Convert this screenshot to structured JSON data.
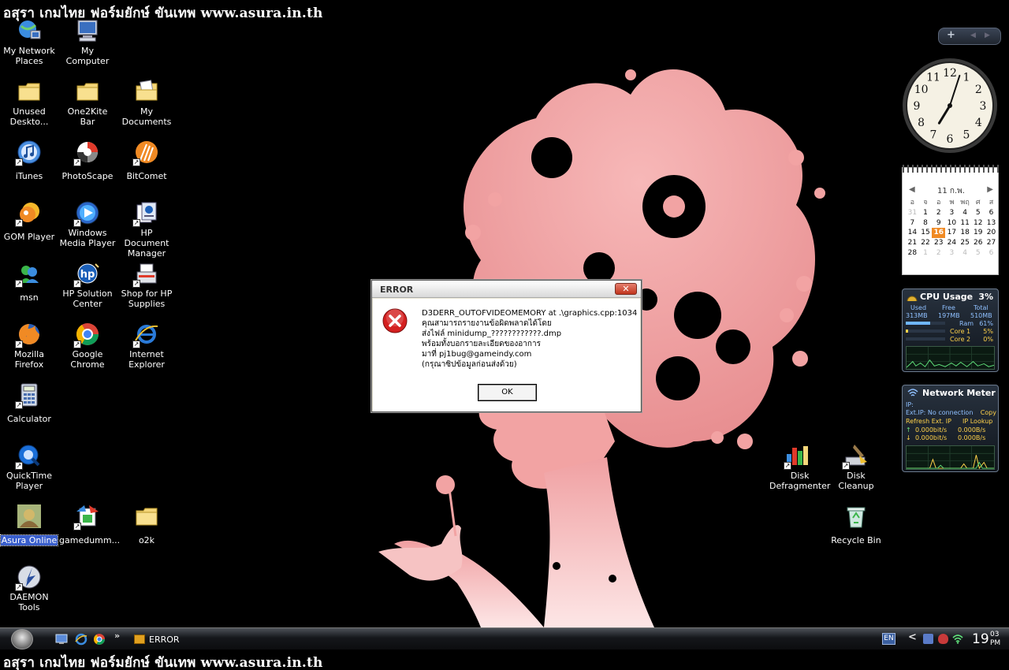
{
  "banner_text": "อสุรา เกมไทย ฟอร์มยักษ์ ขันเทพ www.asura.in.th",
  "desktop_icons": [
    {
      "label": "My Network Places",
      "icon": "network-places-icon"
    },
    {
      "label": "My Computer",
      "icon": "computer-icon"
    },
    {
      "label": "Unused Deskto...",
      "icon": "folder-icon"
    },
    {
      "label": "One2Kite Bar",
      "icon": "folder-icon"
    },
    {
      "label": "My Documents",
      "icon": "documents-folder-icon"
    },
    {
      "label": "iTunes",
      "icon": "itunes-icon"
    },
    {
      "label": "PhotoScape",
      "icon": "photoscape-icon"
    },
    {
      "label": "BitComet",
      "icon": "bitcomet-icon"
    },
    {
      "label": "GOM Player",
      "icon": "gom-player-icon"
    },
    {
      "label": "Windows Media Player",
      "icon": "media-player-icon"
    },
    {
      "label": "HP Document Manager",
      "icon": "hp-document-icon"
    },
    {
      "label": "msn",
      "icon": "msn-icon"
    },
    {
      "label": "HP Solution Center",
      "icon": "hp-solution-icon"
    },
    {
      "label": "Shop for HP Supplies",
      "icon": "hp-shop-icon"
    },
    {
      "label": "Mozilla Firefox",
      "icon": "firefox-icon"
    },
    {
      "label": "Google Chrome",
      "icon": "chrome-icon"
    },
    {
      "label": "Internet Explorer",
      "icon": "internet-explorer-icon"
    },
    {
      "label": "Calculator",
      "icon": "calculator-icon"
    },
    {
      "label": "QuickTime Player",
      "icon": "quicktime-icon"
    },
    {
      "label": "Asura Online",
      "icon": "asura-online-icon"
    },
    {
      "label": "gamedumm...",
      "icon": "gamedummy-icon"
    },
    {
      "label": "o2k",
      "icon": "folder-icon"
    },
    {
      "label": "DAEMON Tools",
      "icon": "daemon-tools-icon"
    },
    {
      "label": "Disk Defragmenter",
      "icon": "disk-defrag-icon"
    },
    {
      "label": "Disk Cleanup",
      "icon": "disk-cleanup-icon"
    },
    {
      "label": "Recycle Bin",
      "icon": "recycle-bin-icon"
    }
  ],
  "dialog": {
    "title": "ERROR",
    "close_label": "✕",
    "lines": [
      "D3DERR_OUTOFVIDEOMEMORY at .\\graphics.cpp:1034",
      "คุณสามารถรายงานข้อผิดพลาดได้โดย",
      "ส่งไฟล์ minidump_????????????.dmp",
      "พร้อมทั้งบอกรายละเอียดของอาการ",
      "มาที่ pj1bug@gameindy.com",
      "(กรุณาซิปข้อมูลก่อนส่งด้วย)"
    ],
    "ok_label": "OK",
    "icon": "error-icon"
  },
  "sidebar": {
    "add_label": "+",
    "prev_label": "◀",
    "next_label": "▶",
    "clock": {
      "hour": 7,
      "minute": 3
    },
    "calendar": {
      "month_label": "11 ก.พ.",
      "prev_label": "◀",
      "next_label": "▶",
      "days_of_week": [
        "อ",
        "จ",
        "อ",
        "พ",
        "พฤ",
        "ศ",
        "ส"
      ],
      "weeks": [
        [
          "31",
          "1",
          "2",
          "3",
          "4",
          "5",
          "6"
        ],
        [
          "7",
          "8",
          "9",
          "10",
          "11",
          "12",
          "13"
        ],
        [
          "14",
          "15",
          "16",
          "17",
          "18",
          "19",
          "20"
        ],
        [
          "21",
          "22",
          "23",
          "24",
          "25",
          "26",
          "27"
        ],
        [
          "28",
          "1",
          "2",
          "3",
          "4",
          "5",
          "6"
        ]
      ],
      "today": "16"
    },
    "cpu": {
      "title": "CPU Usage",
      "percent": "3%",
      "used_label": "Used",
      "free_label": "Free",
      "total_label": "Total",
      "used": "313MB",
      "free": "197MB",
      "total": "510MB",
      "ram_label": "Ram",
      "ram_value": "61%",
      "ram_fraction": 0.61,
      "core1_label": "Core 1",
      "core1_value": "5%",
      "core1_fraction": 0.05,
      "core2_label": "Core 2",
      "core2_value": "0%",
      "core2_fraction": 0.0
    },
    "network": {
      "title": "Network Meter",
      "ip_label": "IP:",
      "ext_ip_text": "Ext.IP: No connection",
      "copy_label": "Copy",
      "refresh_label": "Refresh Ext. IP",
      "lookup_label": "IP Lookup",
      "up_bits": "0.000bit/s",
      "up_bytes": "0.000B/s",
      "down_bits": "0.000bit/s",
      "down_bytes": "0.000B/s"
    }
  },
  "taskbar": {
    "quick_launch": [
      "show-desktop-icon",
      "internet-explorer-icon",
      "chrome-icon"
    ],
    "more_label": "»",
    "task_label": "ERROR",
    "lang": "EN",
    "chevron": "<",
    "time_hour": "19",
    "time_minute": "03",
    "time_ampm": "PM"
  },
  "colors": {
    "wallpaper_silhouette": "#f2a3a3",
    "desktop_bg": "#000000",
    "error_red": "#d42020"
  }
}
